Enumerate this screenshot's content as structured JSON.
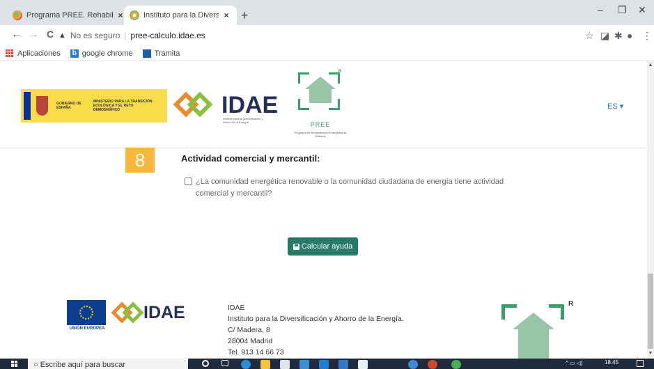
{
  "browser": {
    "tabs": [
      {
        "title": "Programa PREE. Rehabilitación E",
        "active": false
      },
      {
        "title": "Instituto para la Diversificación y",
        "active": true
      }
    ],
    "new_tab": "+",
    "window_controls": {
      "minimize": "–",
      "maximize": "❐",
      "close": "✕"
    },
    "nav": {
      "back": "←",
      "forward": "→",
      "reload": "C"
    },
    "address": {
      "security": "No es seguro",
      "separator": "|",
      "url": "pree-calculo.idae.es"
    },
    "bookmarks": [
      "Aplicaciones",
      "google chrome",
      "Tramita"
    ]
  },
  "header": {
    "gobierno_text": "GOBIERNO DE ESPAÑA",
    "ministerio_text": "MINISTERIO PARA LA TRANSICIÓN ECOLÓGICA Y EL RETO DEMOGRÁFICO",
    "idae_text": "IDAE",
    "idae_subtitle": "Instituto para la Diversificación y Ahorro de la Energía",
    "pree_label": "PREE",
    "pree_subtitle": "Programa de Rehabilitación Energética de Edificios",
    "pree_mark": "R",
    "language": "ES ▾"
  },
  "question": {
    "number": "8",
    "title": "Actividad comercial y mercantil:",
    "text": "¿La comunidad energética renovable o la comunidad ciudadana de energía tiene actividad comercial y mercantil?",
    "checked": false
  },
  "calc_button": "Calcular ayuda",
  "footer": {
    "eu_label": "UNIÓN EUROPEA",
    "idae_text": "IDAE",
    "org": "IDAE",
    "full_name": "Instituto para la Diversificación y Ahorro de la Energía.",
    "address": "C/ Madera, 8",
    "city": "28004 Madrid",
    "phone": "Tel. 913 14 66 73",
    "pree_mark": "R"
  },
  "taskbar": {
    "search_placeholder": "Escribe aquí para buscar",
    "time": "18:45"
  },
  "colors": {
    "accent_green": "#277a6a",
    "step_badge": "#f6b93b",
    "pree_green": "#3a9f6a",
    "link_blue": "#2a79c9"
  }
}
